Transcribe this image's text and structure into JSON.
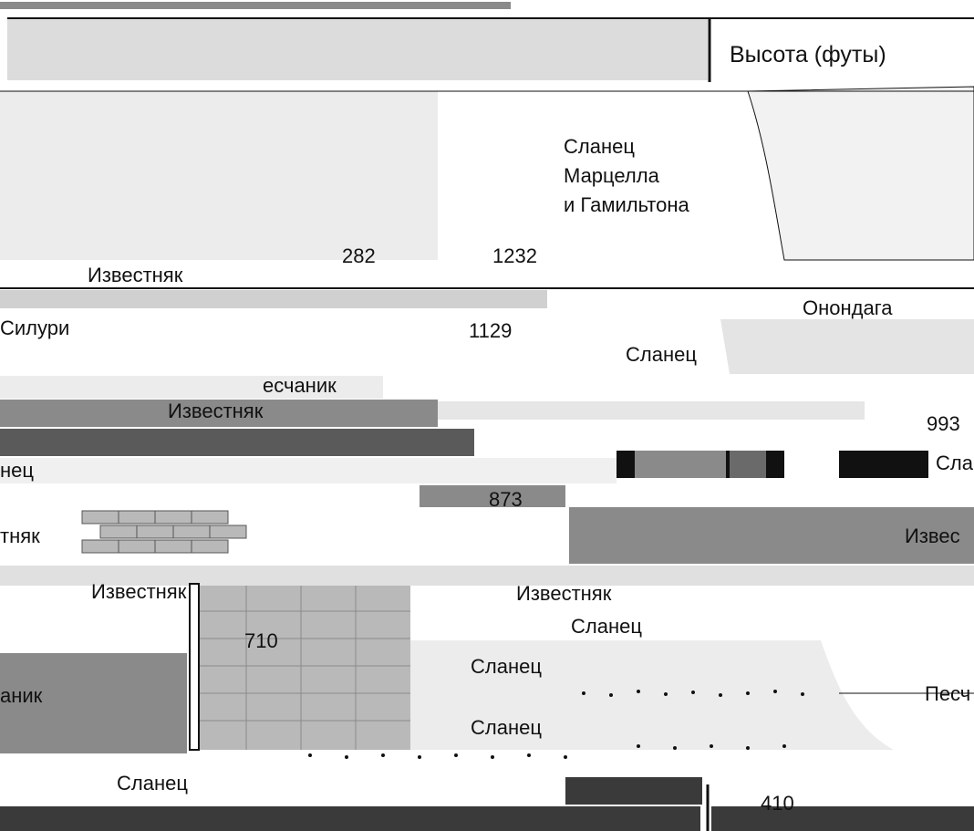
{
  "header": {
    "column_title": "Высота (футы)"
  },
  "elevations": {
    "e1232": "1232",
    "e1129": "1129",
    "e993": "993",
    "e873": "873",
    "e710": "710",
    "e410": "410",
    "e282": "282"
  },
  "formations": {
    "marcellus_line1": "Сланец",
    "marcellus_line2": "Марцелла",
    "marcellus_line3": "и Гамильтона",
    "limestone_top": "Известняк",
    "onondaga": "Онондага",
    "silurian": "Силури",
    "shale_mid": "Сланец",
    "sandstone_mid": "есчаник",
    "limestone_mid": "Известняк",
    "shale_left": "нец",
    "shale_right": "Сла",
    "limestone_left": "тняк",
    "limestone_right": "Извес",
    "limestone_low": "Известняк",
    "limestone_low2": "Известняк",
    "shale_low1": "Сланец",
    "shale_low2": "Сланец",
    "shale_low3": "Сланец",
    "sandstone_left": "аник",
    "sandstone_right": "Песч",
    "shale_bottom": "Сланец"
  },
  "colors": {
    "rock_dark": "#3a3a3a",
    "rock_mid": "#8a8a8a",
    "rock_light": "#b9b9b9",
    "rock_pale": "#dcdcdc",
    "line": "#111111"
  }
}
